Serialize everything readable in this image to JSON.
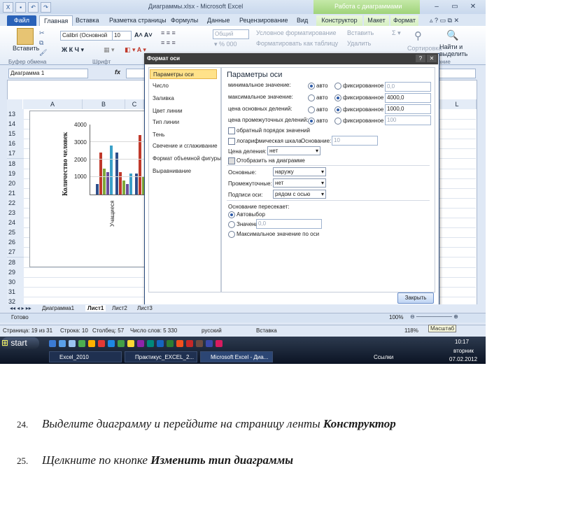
{
  "window": {
    "title": "Диаграммы.xlsx - Microsoft Excel",
    "context_title": "Работа с диаграммами"
  },
  "tabs": [
    "Файл",
    "Главная",
    "Вставка",
    "Разметка страницы",
    "Формулы",
    "Данные",
    "Рецензирование",
    "Вид",
    "Конструктор",
    "Макет",
    "Формат"
  ],
  "ribbon": {
    "paste": "Вставить",
    "font_name": "Calibri (Основной",
    "font_size": "10",
    "number_format": "Общий",
    "cond_format": "Условное форматирование",
    "format_table": "Форматировать как таблицу",
    "insert": "Вставить",
    "delete": "Удалить",
    "sort": "Сортировка",
    "find": "Найти и",
    "select": "выделить",
    "group_clipboard": "Буфер обмена",
    "group_font": "Шрифт",
    "group_edit": "ание"
  },
  "formula_bar": {
    "name_box": "Диаграмма 1",
    "fx": "fx"
  },
  "sheet": {
    "columns": [
      "A",
      "B",
      "C",
      "L"
    ],
    "rows": [
      "13",
      "14",
      "15",
      "16",
      "17",
      "18",
      "19",
      "20",
      "21",
      "22",
      "23",
      "24",
      "25",
      "26",
      "27",
      "28",
      "29",
      "30",
      "31",
      "32"
    ],
    "tabs": [
      "Диаграмма1",
      "Лист1",
      "Лист2",
      "Лист3"
    ],
    "ready": "Готово",
    "zoom": "100%"
  },
  "chart_data": {
    "type": "bar",
    "ylabel": "Количество человек",
    "categories": [
      "Учащиеся"
    ],
    "ylim": [
      0,
      4000
    ],
    "yticks": [
      "4000",
      "3000",
      "2000",
      "1000",
      "0"
    ],
    "series": [
      {
        "values": [
          600,
          2400,
          1200
        ]
      },
      {
        "values": [
          2400,
          1300,
          3400
        ]
      },
      {
        "values": [
          1500,
          800,
          1000
        ]
      },
      {
        "values": [
          1300,
          600,
          700
        ]
      },
      {
        "values": [
          2800,
          1200,
          1500
        ]
      }
    ],
    "colors": [
      "#2e4f8c",
      "#c0392b",
      "#7fa83a",
      "#6a4e9c",
      "#3aa0c8"
    ]
  },
  "dialog": {
    "title": "Формат оси",
    "nav": [
      "Параметры оси",
      "Число",
      "Заливка",
      "Цвет линии",
      "Тип линии",
      "Тень",
      "Свечение и сглаживание",
      "Формат объемной фигуры",
      "Выравнивание"
    ],
    "heading": "Параметры оси",
    "rows": [
      {
        "label": "минимальное значение:",
        "auto": "авто",
        "fixed": "фиксированное",
        "value": "0,0"
      },
      {
        "label": "максимальное значение:",
        "auto": "авто",
        "fixed": "фиксированное",
        "value": "4000,0"
      },
      {
        "label": "цена основных делений:",
        "auto": "авто",
        "fixed": "фиксированное",
        "value": "1000,0"
      },
      {
        "label": "цена промежуточных делений:",
        "auto": "авто",
        "fixed": "фиксированное",
        "value": "100"
      }
    ],
    "reverse_order": "обратный порядок значений",
    "log_scale": "логарифмическая шкала",
    "log_base_label": "Основание:",
    "log_base": "10",
    "units_label": "Цена деления:",
    "units_value": "нет",
    "show_units": "Отобразить на диаграмме",
    "major_label": "Основные:",
    "major_value": "наружу",
    "minor_label": "Промежуточные:",
    "minor_value": "нет",
    "labels_label": "Подписи оси:",
    "labels_value": "рядом с осью",
    "cross_label": "Основание пересекает:",
    "cross_auto": "Автовыбор",
    "cross_value_label": "Значение оси:",
    "cross_value": "0,0",
    "cross_max": "Максимальное значение по оси",
    "close": "Закрыть"
  },
  "word_status": {
    "page": "Страница: 19 из 31",
    "line": "Строка: 10",
    "column": "Столбец: 57",
    "words": "Число слов: 5 330",
    "lang": "русский",
    "mode": "Вставка",
    "zoom": "118%",
    "tooltip": "Масштаб"
  },
  "taskbar": {
    "start": "start",
    "items": [
      "Excel_2010",
      "Практикус_EXCEL_2...",
      "Microsoft Excel - Диа..."
    ],
    "links": "Ссылки",
    "time": "10:17",
    "day": "вторник",
    "date": "07.02.2012"
  },
  "instructions": [
    {
      "num": "24.",
      "text": "Выделите диаграмму и перейдите на страницу ленты ",
      "bold": "Конструктор"
    },
    {
      "num": "25.",
      "text": "Щелкните по кнопке ",
      "bold": "Изменить тип диаграммы"
    }
  ]
}
